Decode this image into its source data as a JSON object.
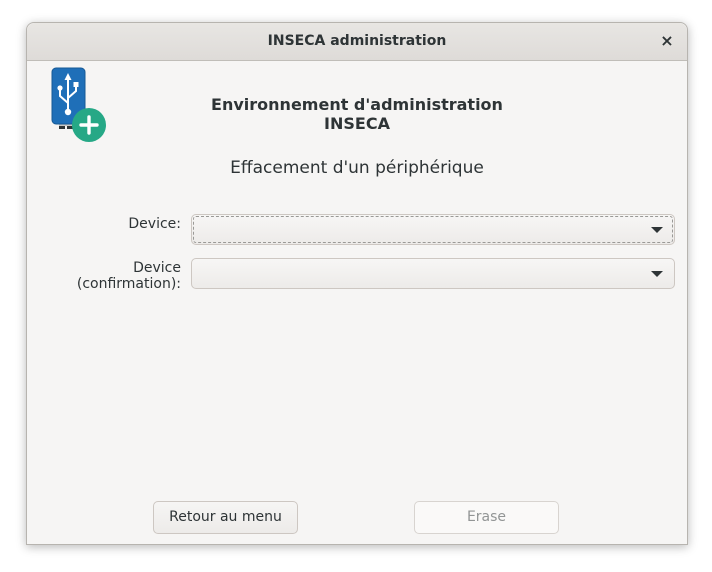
{
  "window": {
    "title": "INSECA administration",
    "close_icon": "close-icon",
    "close_glyph": "×"
  },
  "header": {
    "app_icon": "usb-drive-add-icon",
    "heading": "Environnement d'administration INSECA",
    "subheading": "Effacement d'un périphérique"
  },
  "form": {
    "device": {
      "label": "Device:",
      "value": ""
    },
    "device_confirmation": {
      "label": "Device (confirmation):",
      "value": ""
    }
  },
  "actions": {
    "back_label": "Retour au menu",
    "erase_label": "Erase",
    "erase_enabled": false
  },
  "colors": {
    "usb_blue": "#1f6fb8",
    "plus_green": "#26a886",
    "window_bg": "#f6f5f4"
  }
}
